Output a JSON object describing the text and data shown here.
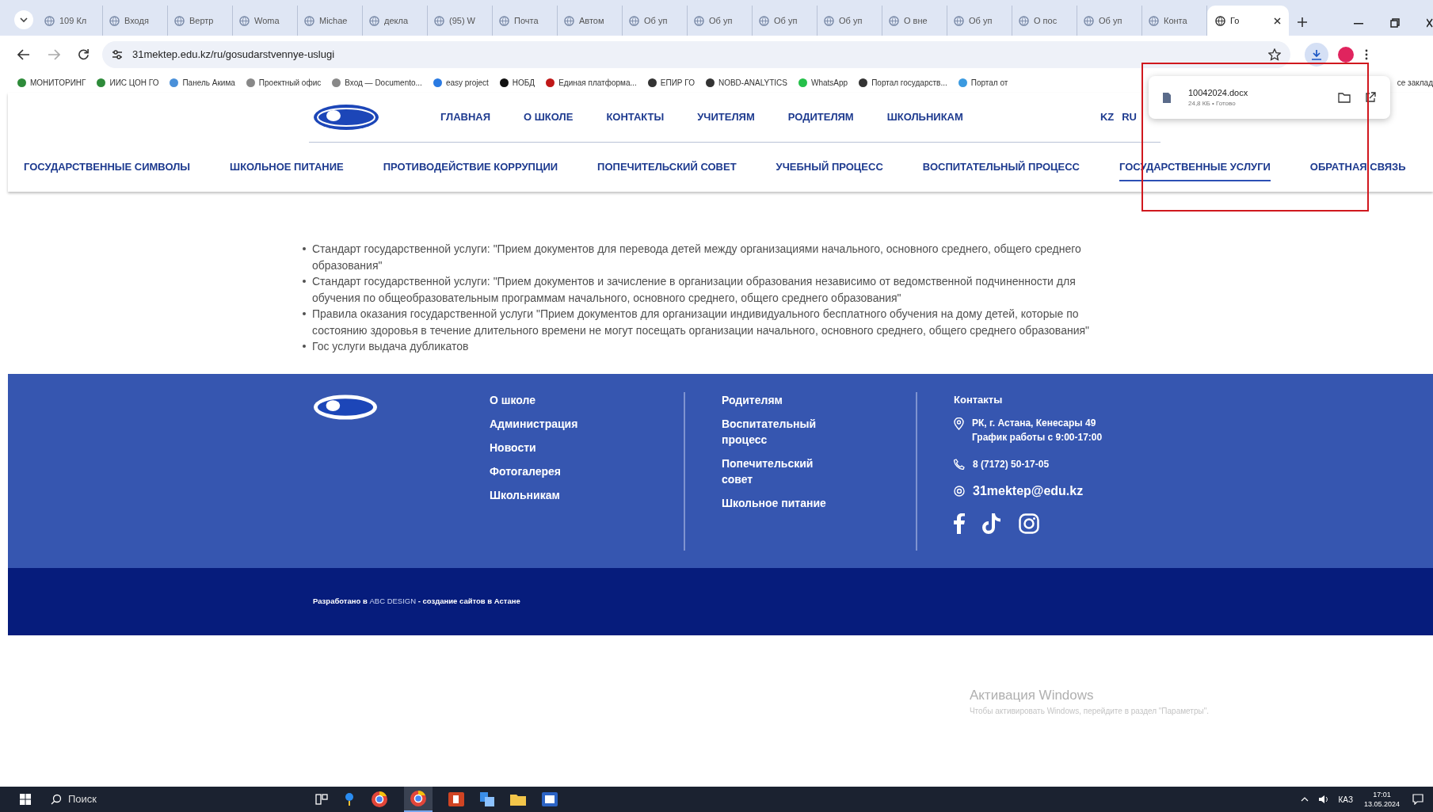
{
  "browser": {
    "tabs": [
      {
        "title": "109 Кл",
        "selected": false
      },
      {
        "title": "Входя",
        "selected": false
      },
      {
        "title": "Вертр",
        "selected": false
      },
      {
        "title": "Woma",
        "selected": false
      },
      {
        "title": "Michae",
        "selected": false
      },
      {
        "title": "декла",
        "selected": false
      },
      {
        "title": "(95) W",
        "selected": false
      },
      {
        "title": "Почта",
        "selected": false
      },
      {
        "title": "Автом",
        "selected": false
      },
      {
        "title": "Об уп",
        "selected": false
      },
      {
        "title": "Об уп",
        "selected": false
      },
      {
        "title": "Об уп",
        "selected": false
      },
      {
        "title": "Об уп",
        "selected": false
      },
      {
        "title": "О вне",
        "selected": false
      },
      {
        "title": "Об уп",
        "selected": false
      },
      {
        "title": "О пос",
        "selected": false
      },
      {
        "title": "Об уп",
        "selected": false
      },
      {
        "title": "Конта",
        "selected": false
      },
      {
        "title": "Го",
        "selected": true
      }
    ],
    "url": "31mektep.edu.kz/ru/gosudarstvennye-uslugi",
    "bookmarks": [
      "МОНИТОРИНГ",
      "ИИС ЦОН ГО",
      "Панель Акима",
      "Проектный офис",
      "Вход — Documento...",
      "easy project",
      "НОБД",
      "Единая платформа...",
      "ЕПИР ГО",
      "NOBD-ANALYTICS",
      "WhatsApp",
      "Портал государств...",
      "Портал от"
    ],
    "bookmarks_end": "се заклад",
    "download": {
      "file": "10042024.docx",
      "details": "24,8 КБ • Готово"
    }
  },
  "site": {
    "top_nav": [
      "ГЛАВНАЯ",
      "О ШКОЛЕ",
      "КОНТАКТЫ",
      "УЧИТЕЛЯМ",
      "РОДИТЕЛЯМ",
      "ШКОЛЬНИКАМ"
    ],
    "languages": [
      "KZ",
      "RU"
    ],
    "section_nav": [
      {
        "label": "ГОСУДАРСТВЕННЫЕ СИМВОЛЫ",
        "selected": false
      },
      {
        "label": "ШКОЛЬНОЕ ПИТАНИЕ",
        "selected": false
      },
      {
        "label": "ПРОТИВОДЕЙСТВИЕ КОРРУПЦИИ",
        "selected": false
      },
      {
        "label": "ПОПЕЧИТЕЛЬСКИЙ СОВЕТ",
        "selected": false
      },
      {
        "label": "УЧЕБНЫЙ ПРОЦЕСС",
        "selected": false
      },
      {
        "label": "ВОСПИТАТЕЛЬНЫЙ ПРОЦЕСС",
        "selected": false
      },
      {
        "label": "ГОСУДАРСТВЕННЫЕ УСЛУГИ",
        "selected": true
      },
      {
        "label": "ОБРАТНАЯ СВЯЗЬ",
        "selected": false
      }
    ],
    "content": [
      "Стандарт государственной услуги: \"Прием документов для перевода детей между организациями начального, основного среднего, общего среднего образования\"",
      "Стандарт государственной услуги: \"Прием документов и зачисление в организации образования независимо от ведомственной подчиненности для обучения по общеобразовательным программам начального, основного среднего, общего среднего образования\"",
      "Правила оказания государственной услуги \"Прием документов для организации индивидуального бесплатного обучения на дому детей, которые по состоянию здоровья в течение длительного времени не могут посещать организации начального, основного среднего, общего среднего образования\"",
      "Гос услуги выдача дубликатов"
    ],
    "footer": {
      "column_1": [
        "О школе",
        "Администрация",
        "Новости",
        "Фотогалерея",
        "Школьникам"
      ],
      "column_2": [
        "Родителям",
        "Воспитательный процесс",
        "Попечительский совет",
        "Школьное питание"
      ],
      "contacts": {
        "heading": "Контакты",
        "address_lines": [
          "РК, г. Астана, Кенесары 49",
          "График работы с 9:00-17:00"
        ],
        "phone": "8 (7172) 50-17-05",
        "email": "31mektep@edu.kz"
      },
      "credit": {
        "before": "Разработано в ",
        "link": "ABC DESIGN",
        "after": " - создание сайтов в Астане"
      }
    }
  },
  "annotation": {
    "kind": "rectangle"
  },
  "os_notice": {
    "title": "Активация Windows",
    "text": "Чтобы активировать Windows, перейдите в раздел \"Параметры\"."
  },
  "taskbar": {
    "search_placeholder": "Поиск",
    "language": "КАЗ",
    "time": "17:01",
    "date": "13.05.2024"
  }
}
